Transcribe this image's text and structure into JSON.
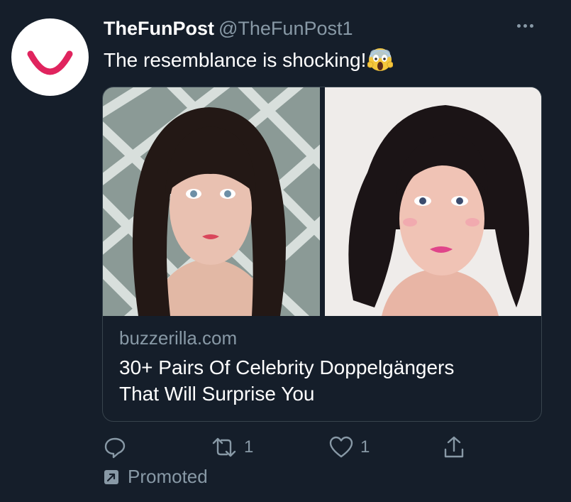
{
  "tweet": {
    "author_name": "TheFunPost",
    "author_handle": "@TheFunPost1",
    "text": "The resemblance is shocking!",
    "emoji": "screaming-face"
  },
  "card": {
    "domain": "buzzerilla.com",
    "title_line1": "30+ Pairs Of Celebrity Doppelgängers",
    "title_line2": "That Will Surprise You"
  },
  "actions": {
    "reply": {
      "icon": "reply-icon",
      "count": ""
    },
    "retweet": {
      "icon": "retweet-icon",
      "count": "1"
    },
    "like": {
      "icon": "heart-icon",
      "count": "1"
    },
    "share": {
      "icon": "share-icon"
    }
  },
  "promoted_label": "Promoted",
  "colors": {
    "background": "#151e2a",
    "secondary_text": "#8899a6",
    "brand_logo": "#e0245e",
    "border": "#38444d"
  }
}
